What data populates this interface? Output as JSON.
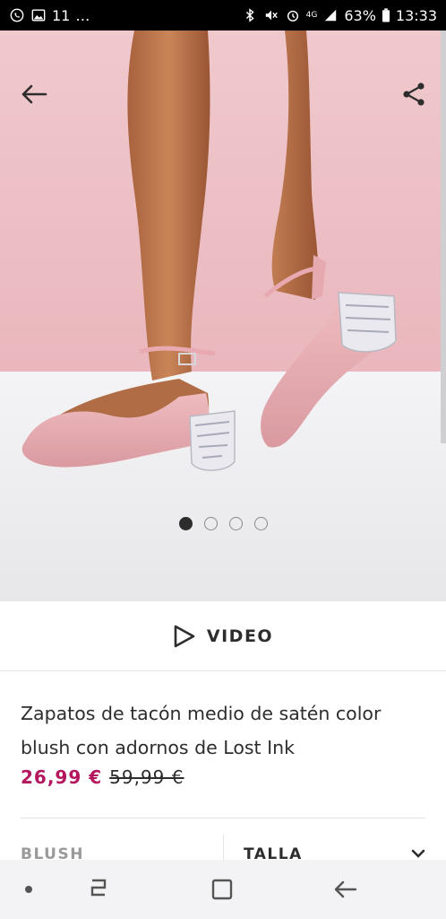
{
  "status_bar": {
    "notification_count": "11",
    "ellipsis": "…",
    "network": "4G",
    "battery": "63%",
    "time": "13:33"
  },
  "icons": {
    "back": "back-arrow-icon",
    "share": "share-icon",
    "video": "play-icon",
    "size_dropdown": "chevron-down-icon"
  },
  "carousel": {
    "total": 4,
    "active_index": 0
  },
  "video": {
    "label": "VIDEO"
  },
  "product": {
    "title": "Zapatos de tacón medio de satén color blush con adornos de Lost Ink",
    "price_current": "26,99 €",
    "price_original": "59,99 €"
  },
  "options": {
    "color": "BLUSH",
    "size": "TALLA"
  },
  "colors": {
    "price_accent": "#b5175e",
    "text": "#2d2d2d",
    "muted": "#9a9a9a"
  }
}
